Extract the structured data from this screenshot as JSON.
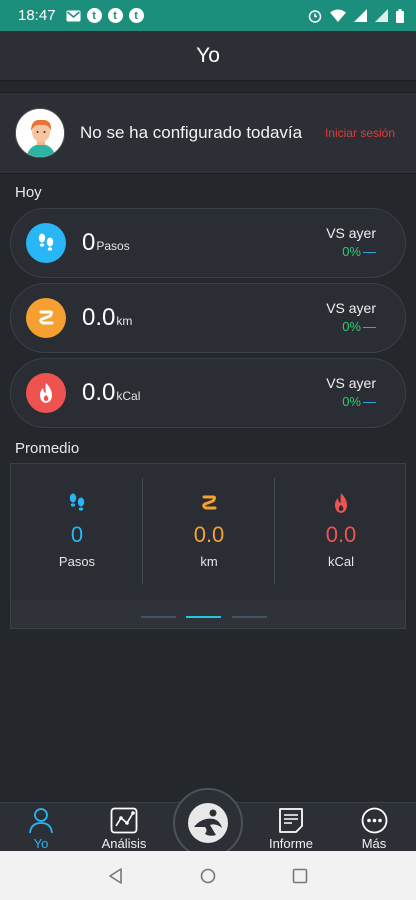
{
  "status_bar": {
    "time": "18:47",
    "notification_badges": [
      "M",
      "t",
      "t",
      "t"
    ],
    "icons": [
      "mail-icon",
      "tumblr-icon",
      "alarm-icon",
      "wifi-icon",
      "signal-icon",
      "battery-icon"
    ]
  },
  "header": {
    "title": "Yo"
  },
  "profile": {
    "name": "No se ha configurado todavía",
    "login_label": "Iniciar sesión"
  },
  "today": {
    "section_title": "Hoy",
    "cards": [
      {
        "icon": "footsteps-icon",
        "color": "#29b6f6",
        "value": "0",
        "unit": "Pasos",
        "vs_label": "VS ayer",
        "vs_percent": "0%",
        "vs_indicator": "—"
      },
      {
        "icon": "route-icon",
        "color": "#f5a030",
        "value": "0.0",
        "unit": "km",
        "vs_label": "VS ayer",
        "vs_percent": "0%",
        "vs_indicator": "—"
      },
      {
        "icon": "flame-icon",
        "color": "#ef5350",
        "value": "0.0",
        "unit": "kCal",
        "vs_label": "VS ayer",
        "vs_percent": "0%",
        "vs_indicator": "—"
      }
    ]
  },
  "average": {
    "section_title": "Promedio",
    "items": [
      {
        "icon": "footsteps-icon",
        "color": "#29b6f6",
        "value": "0",
        "unit": "Pasos"
      },
      {
        "icon": "route-icon",
        "color": "#f5a030",
        "value": "0.0",
        "unit": "km"
      },
      {
        "icon": "flame-icon",
        "color": "#ef5350",
        "value": "0.0",
        "unit": "kCal"
      }
    ],
    "page_count": 3,
    "active_page": 2
  },
  "tabs": [
    {
      "label": "Yo",
      "icon": "person-icon",
      "active": true
    },
    {
      "label": "Análisis",
      "icon": "chart-icon",
      "active": false
    },
    {
      "label": "Informe",
      "icon": "report-icon",
      "active": false
    },
    {
      "label": "Más",
      "icon": "more-icon",
      "active": false
    }
  ],
  "center_button": {
    "icon": "runner-logo-icon"
  },
  "system_nav": {
    "icons": [
      "back-icon",
      "home-icon",
      "recents-icon"
    ]
  },
  "colors": {
    "status_bar": "#1c8f7c",
    "accent": "#29b6f6",
    "positive": "#2ecc71",
    "login": "#e53935"
  }
}
